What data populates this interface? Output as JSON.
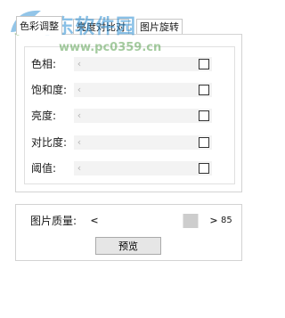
{
  "tabs": [
    {
      "label": "色彩调整"
    },
    {
      "label": "亮度对比对"
    },
    {
      "label": "图片旋转"
    }
  ],
  "adjustments": {
    "rows": [
      {
        "label": "色相:",
        "checked": false
      },
      {
        "label": "饱和度:",
        "checked": false
      },
      {
        "label": "亮度:",
        "checked": false
      },
      {
        "label": "对比度:",
        "checked": false
      },
      {
        "label": "阈值:",
        "checked": false
      }
    ]
  },
  "quality": {
    "label": "图片质量:",
    "value": "85",
    "level_percent": 85
  },
  "preview_button": {
    "label": "预览"
  },
  "icons": {
    "arrow_left": "‹",
    "arrow_right": "›",
    "quality_left": "<",
    "quality_right": ">"
  },
  "watermark": {
    "title": "河东软件园",
    "url": "www.pc0359.cn"
  }
}
